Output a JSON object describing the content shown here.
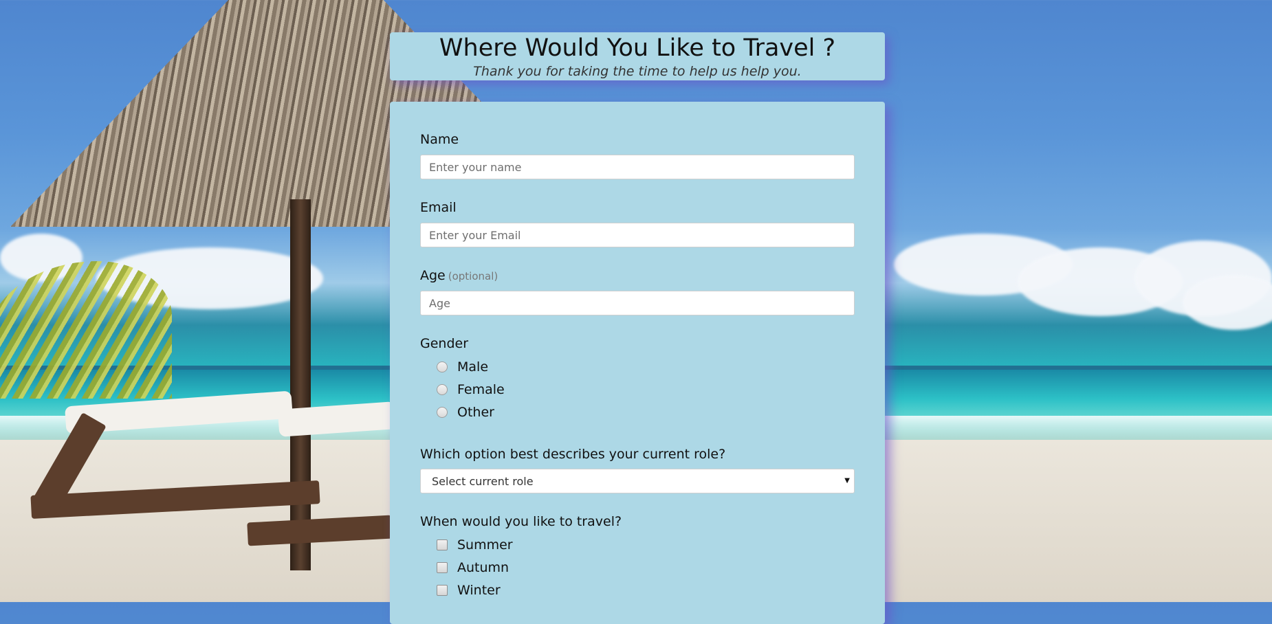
{
  "header": {
    "title": "Where Would You Like to Travel ?",
    "subtitle": "Thank you for taking the time to help us help you."
  },
  "form": {
    "name": {
      "label": "Name",
      "placeholder": "Enter your name"
    },
    "email": {
      "label": "Email",
      "placeholder": "Enter your Email"
    },
    "age": {
      "label": "Age",
      "optional": "(optional)",
      "placeholder": "Age"
    },
    "gender": {
      "label": "Gender",
      "options": [
        "Male",
        "Female",
        "Other"
      ]
    },
    "role": {
      "label": "Which option best describes your current role?",
      "selected": "Select current role"
    },
    "travel": {
      "label": "When would you like to travel?",
      "options": [
        "Summer",
        "Autumn",
        "Winter"
      ]
    }
  },
  "icons": {
    "select_arrow": "chevron-down-icon"
  },
  "colors": {
    "card_background": "#add8e6",
    "card_shadow": "#6e50c8"
  }
}
